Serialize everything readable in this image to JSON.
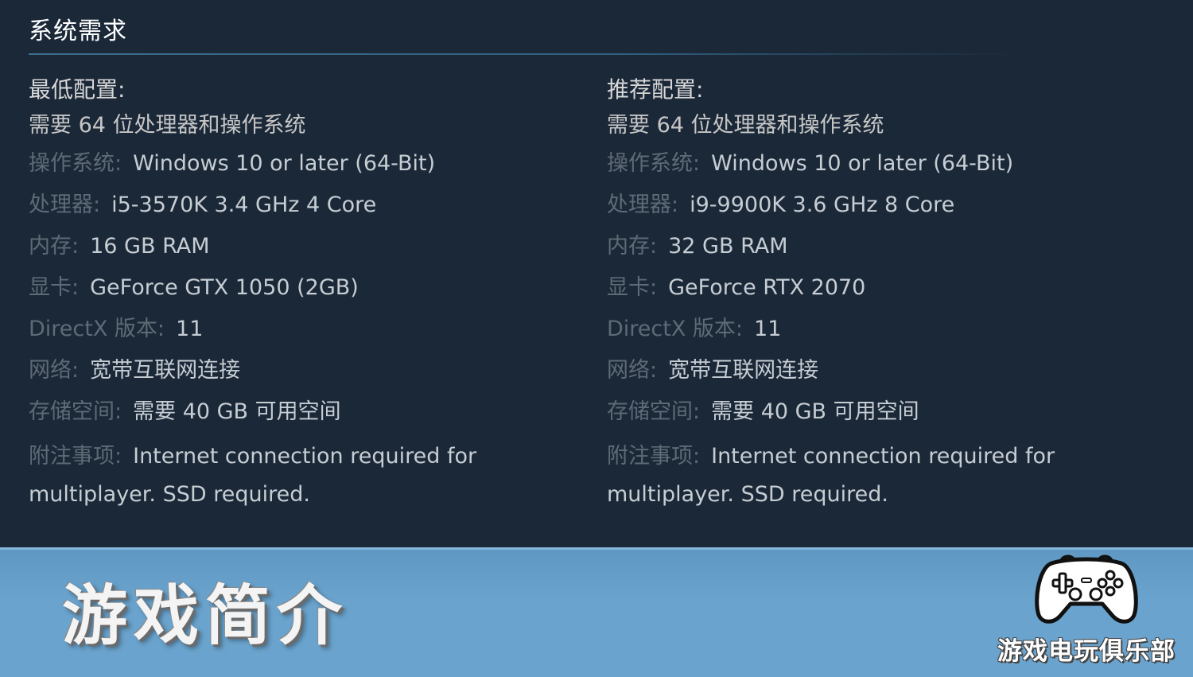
{
  "section_title": "系统需求",
  "minimum": {
    "heading": "最低配置:",
    "requires_64bit": "需要 64 位处理器和操作系统",
    "specs": [
      {
        "label": "操作系统:",
        "value": "Windows 10 or later (64-Bit)"
      },
      {
        "label": "处理器:",
        "value": "i5-3570K 3.4 GHz 4 Core"
      },
      {
        "label": "内存:",
        "value": "16 GB RAM"
      },
      {
        "label": "显卡:",
        "value": "GeForce GTX 1050 (2GB)"
      },
      {
        "label": "DirectX 版本:",
        "value": "11"
      },
      {
        "label": "网络:",
        "value": "宽带互联网连接"
      },
      {
        "label": "存储空间:",
        "value": "需要 40 GB 可用空间"
      }
    ],
    "notes": {
      "label": "附注事项:",
      "value": "Internet connection required for multiplayer. SSD required."
    }
  },
  "recommended": {
    "heading": "推荐配置:",
    "requires_64bit": "需要 64 位处理器和操作系统",
    "specs": [
      {
        "label": "操作系统:",
        "value": "Windows 10 or later (64-Bit)"
      },
      {
        "label": "处理器:",
        "value": "i9-9900K 3.6 GHz 8 Core"
      },
      {
        "label": "内存:",
        "value": "32 GB RAM"
      },
      {
        "label": "显卡:",
        "value": "GeForce RTX 2070"
      },
      {
        "label": "DirectX 版本:",
        "value": "11"
      },
      {
        "label": "网络:",
        "value": "宽带互联网连接"
      },
      {
        "label": "存储空间:",
        "value": "需要 40 GB 可用空间"
      }
    ],
    "notes": {
      "label": "附注事项:",
      "value": "Internet connection required for multiplayer. SSD required."
    }
  },
  "banner": {
    "title": "游戏简介",
    "brand_name": "游戏电玩俱乐部",
    "icon": "gamepad-icon"
  },
  "colors": {
    "background": "#1b2838",
    "banner": "#6aa3cd",
    "label_gray": "#5e6a75",
    "value_text": "#c6cdd3"
  }
}
